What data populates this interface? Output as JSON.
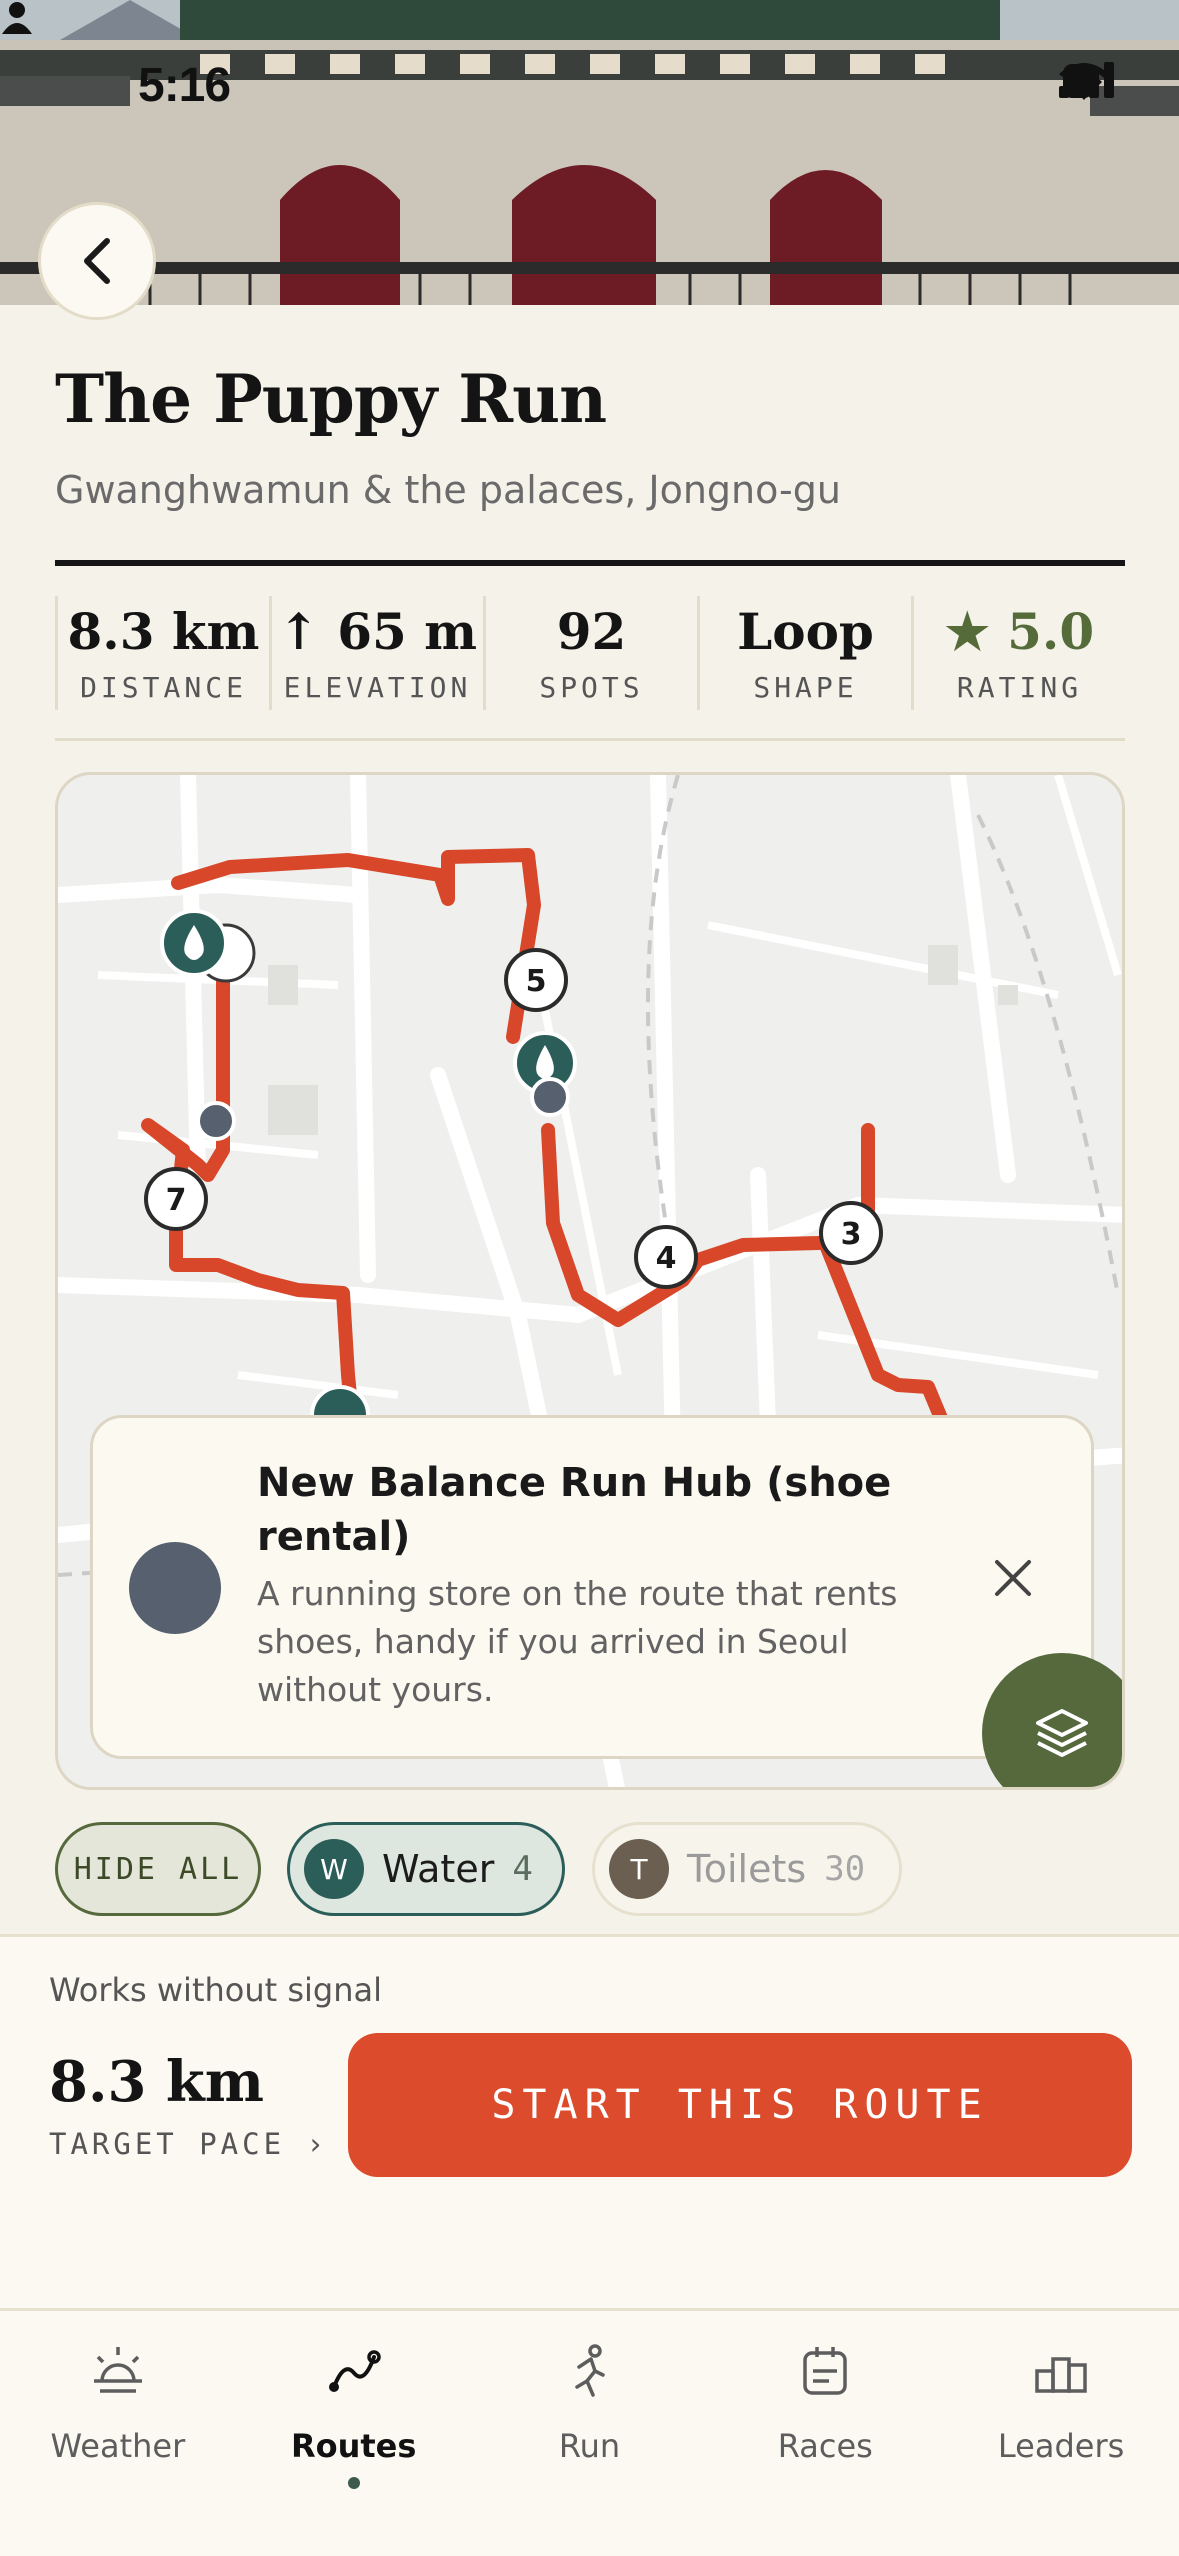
{
  "status_bar": {
    "time": "5:16"
  },
  "route": {
    "title": "The Puppy Run",
    "subtitle": "Gwanghwamun & the palaces, Jongno-gu"
  },
  "stats": [
    {
      "value": "8.3 km",
      "label": "DISTANCE"
    },
    {
      "value": "↑ 65 m",
      "label": "ELEVATION"
    },
    {
      "value": "92",
      "label": "SPOTS"
    },
    {
      "value": "Loop",
      "label": "SHAPE"
    },
    {
      "value": "★ 5.0",
      "label": "RATING"
    }
  ],
  "map": {
    "route_color": "#d8472a",
    "waypoints": [
      "5",
      "7",
      "4",
      "3"
    ],
    "poi_card": {
      "title": "New Balance Run Hub (shoe rental)",
      "description": "A running store on the route that rents shoes, handy if you arrived in Seoul without yours."
    }
  },
  "filters": {
    "hide_all": "HIDE ALL",
    "water": {
      "badge": "W",
      "label": "Water",
      "count": "4"
    },
    "toilets": {
      "badge": "T",
      "label": "Toilets",
      "count": "30"
    }
  },
  "bottom": {
    "offline": "Works without signal",
    "target_distance": "8.3 km",
    "target_pace": "TARGET PACE ›",
    "start": "START THIS ROUTE"
  },
  "tabs": [
    {
      "label": "Weather",
      "icon": "sun-icon"
    },
    {
      "label": "Routes",
      "icon": "route-icon"
    },
    {
      "label": "Run",
      "icon": "runner-icon"
    },
    {
      "label": "Races",
      "icon": "calendar-icon"
    },
    {
      "label": "Leaders",
      "icon": "podium-icon"
    }
  ],
  "colors": {
    "accent": "#db4b2c",
    "green": "#56693d",
    "teal": "#2c5e59"
  }
}
